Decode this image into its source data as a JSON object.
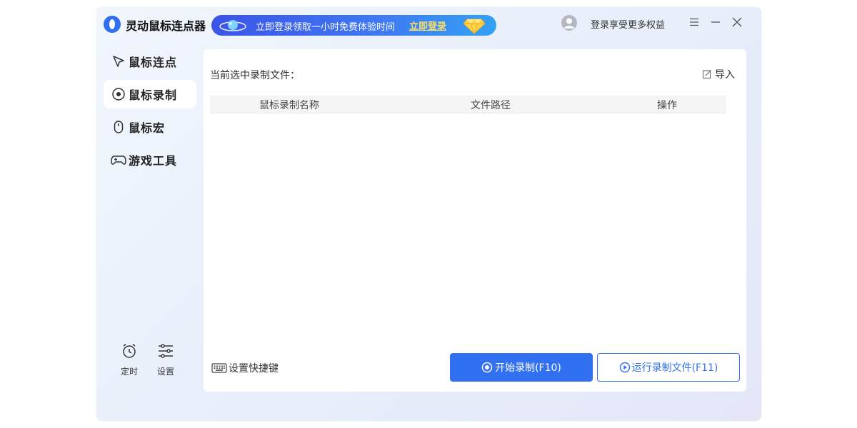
{
  "app": {
    "title": "灵动鼠标连点器"
  },
  "promo": {
    "text": "立即登录领取一小时免费体验时间",
    "link": "立即登录"
  },
  "header": {
    "login_text": "登录享受更多权益"
  },
  "sidebar": {
    "items": [
      {
        "label": "鼠标连点",
        "icon": "cursor-icon"
      },
      {
        "label": "鼠标录制",
        "icon": "record-icon"
      },
      {
        "label": "鼠标宏",
        "icon": "mouse-icon"
      },
      {
        "label": "游戏工具",
        "icon": "gamepad-icon"
      }
    ],
    "active_index": 1
  },
  "tools": {
    "timer_label": "定时",
    "settings_label": "设置"
  },
  "main": {
    "current_file_label": "当前选中录制文件：",
    "import_label": "导入",
    "table": {
      "columns": [
        "鼠标录制名称",
        "文件路径",
        "操作"
      ],
      "rows": []
    },
    "shortcut_label": "设置快捷键",
    "start_button": "开始录制(F10)",
    "run_button": "运行录制文件(F11)"
  },
  "colors": {
    "accent": "#3171f1",
    "promo_gradient_start": "#3b54e6",
    "promo_gradient_end": "#33a2f5",
    "promo_link": "#ffe066"
  }
}
